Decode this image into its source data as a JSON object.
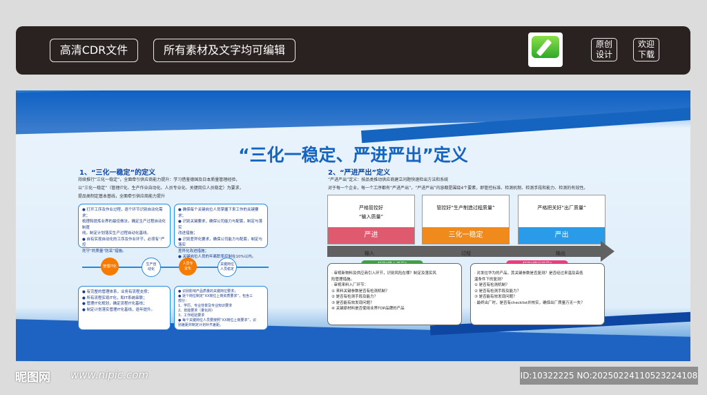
{
  "topbar": {
    "tag_cdr": "高清CDR文件",
    "tag_editable": "所有素材及文字均可编辑",
    "tag_original": [
      "原创",
      "设计"
    ],
    "tag_download": [
      "欢迎",
      "下载"
    ]
  },
  "board": {
    "title": "“三化一稳定、严进严出”定义",
    "left": {
      "heading": "1、“三化一稳定”的定义",
      "intro": [
        "持续推行“三化一稳定”，全面牵引供应商能力提升：学习借鉴德国及日本质量管理经验，",
        "以“三化一稳定”（管理IT化、生产作业自动化、人员专业化、关键岗位人员稳定）为要求，",
        "提品类制定基本基线，全面牵引供应商能力提升"
      ],
      "box1": [
        "● 打开工序及作业过程，逐个环节识别自动化需求；",
        "梳理和提炼业界的最佳做法，确定生产过程自动化制度",
        "线，制定计划落实生产过程自动化基线。",
        "● 自有实现自动化的工序及作业环节，必须有“严控",
        "死守”的质量“防呆”措施。"
      ],
      "box2": [
        "● 确保每个关键岗位人员掌握下来工作的关键要求；",
        "● 识别关键要求，确保公司能力与配套，制定与落实",
        "改进措施；",
        "● 识别差异化要求，确保公司能力与配套，制定与落实",
        "差异化改进措施；",
        "● 关键岗位人员的年离职率控制在10%以内。"
      ],
      "box3": [
        "● 有完整的管理体系，业务有流程支撑；",
        "● 所有流程实现IT化，和IT系统串联；",
        "● 管理IT化规划，确定流程IT化基线；",
        "● 制定计划落实管理IT化基线，逐年提升。"
      ],
      "box4": [
        "● 识别影响产品质量的关键岗位要求；",
        "● 逐个岗位制定“XX岗位上岗资质要求”，包含三",
        "部分：",
        "1、学历、专业背景及专业知识要求",
        "2、技能要求（量化的）",
        "3、工作经验要求",
        "● 每个关键岗位人员要按照“XX岗位上岗要求”，识",
        "别差距并制定计划补齐差距。"
      ],
      "nodes": {
        "it": "管理IT化",
        "auto": [
          "生产自",
          "动化"
        ],
        "pro": [
          "人员专",
          "业化"
        ],
        "stable": [
          "关键岗位",
          "人员稳定"
        ]
      }
    },
    "right": {
      "heading": "2、“严进严出”定义",
      "intro": [
        "“严进严出”定义：按品类推动供应商建立问题快速检出方法和系统",
        "对于每一个企业，每一个工序都有“严进严出”，“严进严出”内容都是围绕4个要素，即管控标准、检测机制、检测手段和能力、检测的有效性。"
      ],
      "cards": [
        {
          "text": [
            "严格管控好",
            "“输入质量”"
          ],
          "band": "严进",
          "color": "#e05a6f"
        },
        {
          "text": [
            "管控好“生产制造过程质量”"
          ],
          "band": "三化一稳定",
          "color": "#f08a1c"
        },
        {
          "text": [
            "严格把关好“出厂质量”"
          ],
          "band": "严出",
          "color": "#2a9be8"
        }
      ],
      "process_labels": {
        "input": "输入",
        "process": "过程",
        "output": "输出"
      },
      "pill_in": "打开“输入环节”",
      "pill_out": "打开“输出环节”",
      "box_in": [
        "· 审视新物料及供应商引入环节，识别风险在哪？制定及落实风",
        "险管理措施。",
        "· 审视来料入厂环节：",
        "① 来料关键参数是否有检测机制？",
        "② 是否有检测手段及能力？",
        "③ 是否能有效发现问题？",
        "④ 关键原材料是否使用业界TOP品牌的产品"
      ],
      "box_out": [
        "· 对发往华为的产品，其关键参数是否复测？是否经过来温及高低",
        "温条件下的复测？",
        "① 是否有检测机制？",
        "② 是否有检测手段及能力？",
        "③ 是否能有效发现问题？",
        "· 最终出厂时，是否有checklist并核实，确保出厂质量万无一失？"
      ]
    }
  },
  "footer": {
    "logo": "昵图网",
    "url": "www.nipic.com",
    "id": "ID:10322225 NO:20250224110523224108"
  },
  "colors": {
    "accent_blue": "#1565c0",
    "red": "#e05a6f",
    "orange": "#f08a1c",
    "sky": "#2a9be8",
    "green_pill": "#43a047",
    "pink_pill": "#ec407a"
  }
}
